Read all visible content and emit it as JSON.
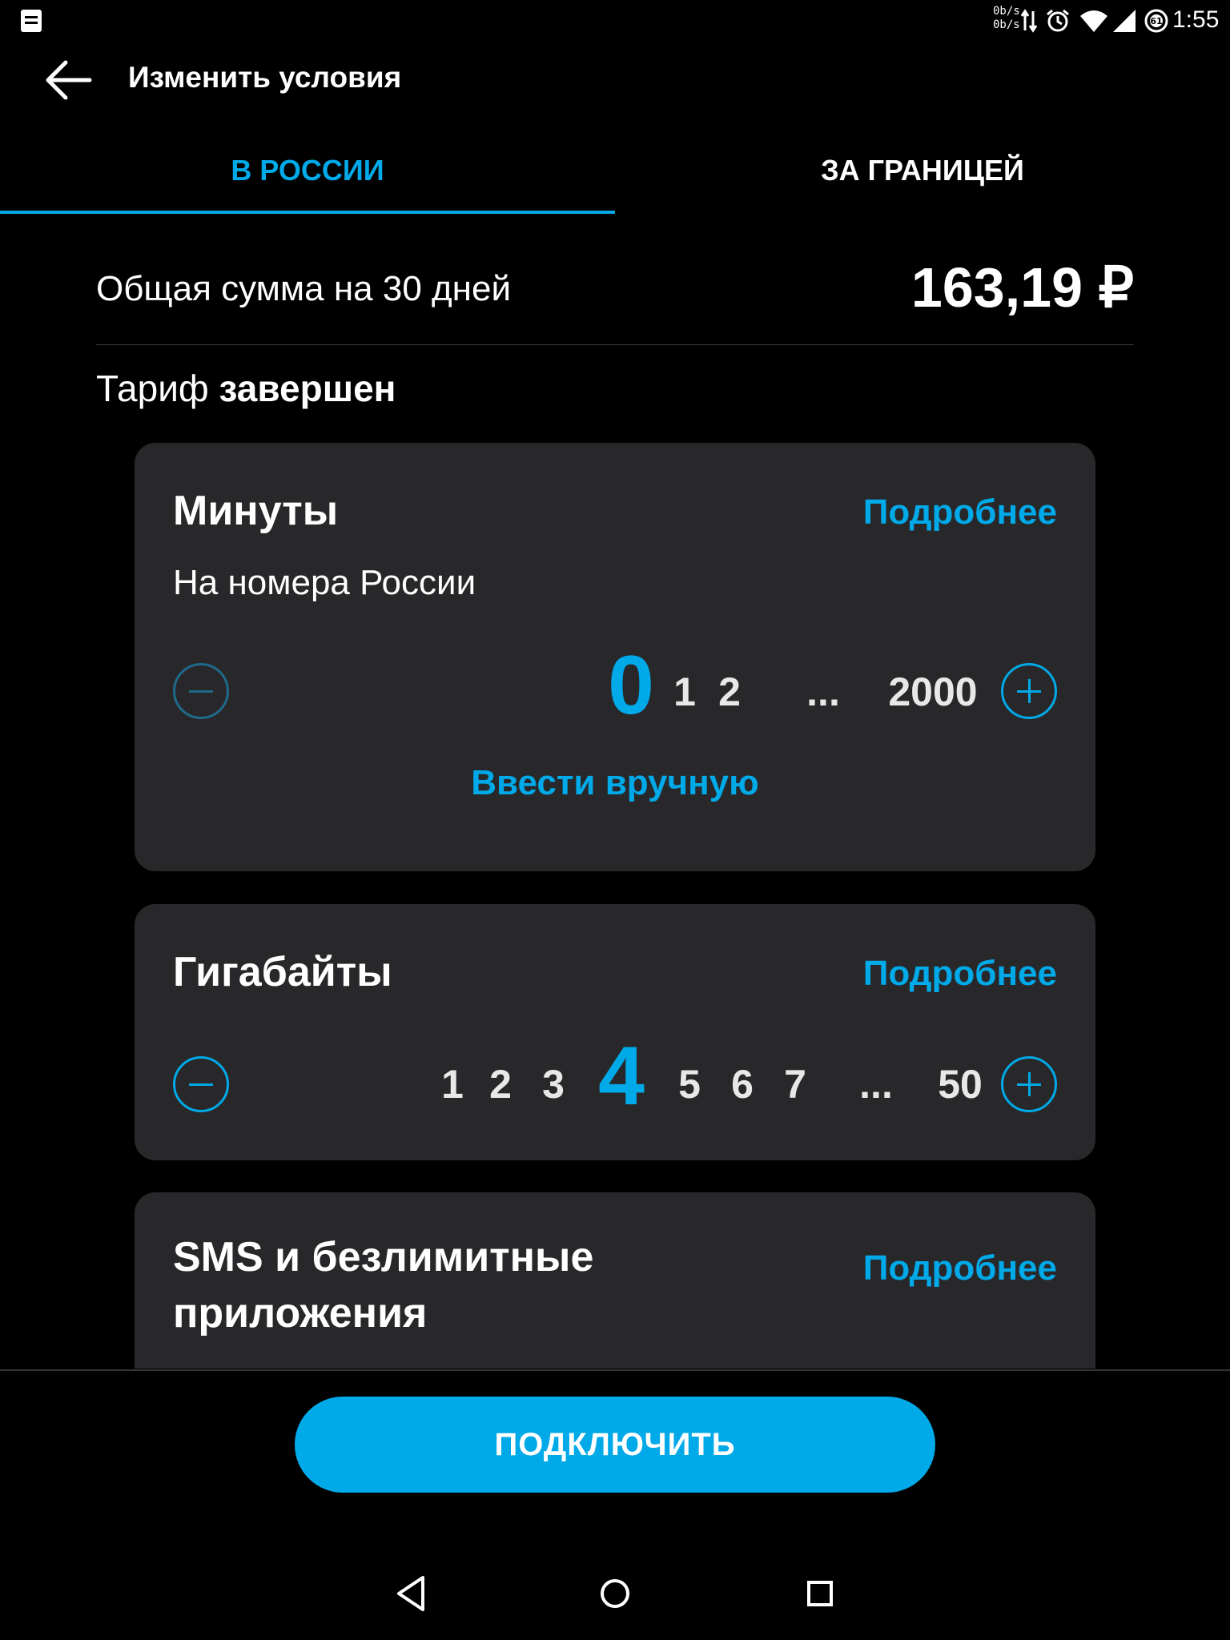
{
  "status_bar": {
    "net_up": "0b/s",
    "net_down": "0b/s",
    "battery": "61",
    "time": "1:55"
  },
  "header": {
    "title": "Изменить условия"
  },
  "tabs": [
    {
      "label": "В РОССИИ",
      "active": true
    },
    {
      "label": "ЗА ГРАНИЦЕЙ",
      "active": false
    }
  ],
  "summary": {
    "total_label": "Общая сумма на 30 дней",
    "total_value": "163,19 ₽",
    "tariff_prefix": "Тариф",
    "tariff_status": "завершен"
  },
  "cards": {
    "minutes": {
      "title": "Минуты",
      "more": "Подробнее",
      "subtitle": "На номера России",
      "scale": [
        "0",
        "1",
        "2",
        "...",
        "2000"
      ],
      "selected": "0",
      "manual": "Ввести вручную"
    },
    "gigabytes": {
      "title": "Гигабайты",
      "more": "Подробнее",
      "scale": [
        "1",
        "2",
        "3",
        "4",
        "5",
        "6",
        "7",
        "...",
        "50"
      ],
      "selected": "4"
    },
    "sms": {
      "title_line1": "SMS и безлимитные",
      "title_line2": "приложения",
      "more": "Подробнее"
    }
  },
  "footer": {
    "connect_label": "ПОДКЛЮЧИТЬ"
  },
  "colors": {
    "accent": "#00a9e8",
    "card_bg": "#28282b",
    "background": "#000000"
  }
}
